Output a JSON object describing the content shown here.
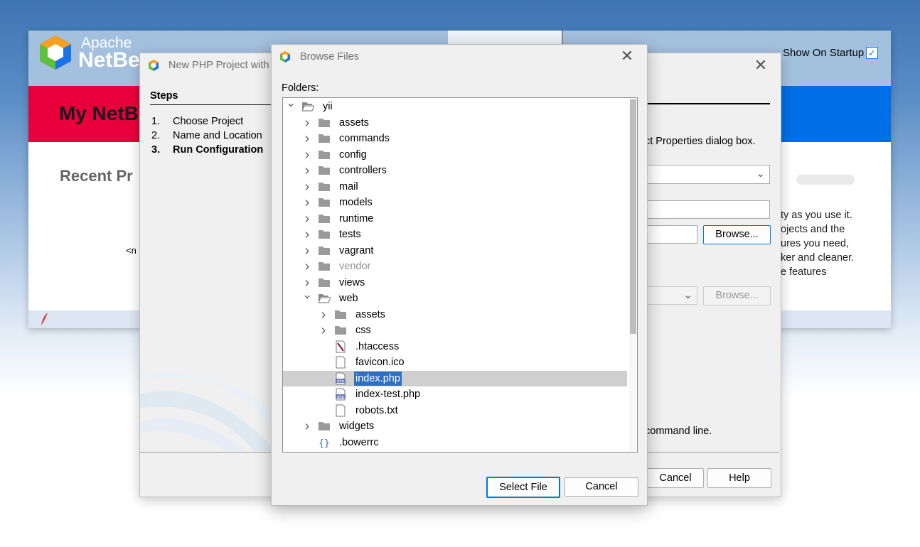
{
  "netbeans": {
    "logo_top": "Apache",
    "logo_bottom": "NetBe",
    "show_on_startup_label": "Show On Startup",
    "show_on_startup_checked": true,
    "my_title": "My NetB",
    "recent_projects": "Recent Pr",
    "no_projects": "<n",
    "right_text": [
      "ty as you use it.",
      "ojects and the",
      "ures you need,",
      "ker and cleaner.",
      "e features"
    ],
    "colors": {
      "red_band": "#e8003c",
      "blue_band": "#006ee6"
    }
  },
  "wizard": {
    "title": "New PHP Project with",
    "steps_heading": "Steps",
    "steps": [
      {
        "num": "1.",
        "label": "Choose Project",
        "current": false
      },
      {
        "num": "2.",
        "label": "Name and Location",
        "current": false
      },
      {
        "num": "3.",
        "label": "Run Configuration",
        "current": true
      }
    ],
    "description": "ct Properties dialog box.",
    "browse_label": "Browse...",
    "browse_disabled_label": "Browse...",
    "cmdline_text": "command line.",
    "cancel_label": "Cancel",
    "help_label": "Help"
  },
  "browse": {
    "title": "Browse Files",
    "folders_label": "Folders:",
    "select_label": "Select File",
    "cancel_label": "Cancel",
    "tree": [
      {
        "label": "yii",
        "depth": 0,
        "type": "folder-open",
        "chevron": "down"
      },
      {
        "label": "assets",
        "depth": 1,
        "type": "folder",
        "chevron": "right"
      },
      {
        "label": "commands",
        "depth": 1,
        "type": "folder",
        "chevron": "right"
      },
      {
        "label": "config",
        "depth": 1,
        "type": "folder",
        "chevron": "right"
      },
      {
        "label": "controllers",
        "depth": 1,
        "type": "folder",
        "chevron": "right"
      },
      {
        "label": "mail",
        "depth": 1,
        "type": "folder",
        "chevron": "right"
      },
      {
        "label": "models",
        "depth": 1,
        "type": "folder",
        "chevron": "right"
      },
      {
        "label": "runtime",
        "depth": 1,
        "type": "folder",
        "chevron": "right"
      },
      {
        "label": "tests",
        "depth": 1,
        "type": "folder",
        "chevron": "right"
      },
      {
        "label": "vagrant",
        "depth": 1,
        "type": "folder",
        "chevron": "right"
      },
      {
        "label": "vendor",
        "depth": 1,
        "type": "folder",
        "chevron": "right",
        "dim": true
      },
      {
        "label": "views",
        "depth": 1,
        "type": "folder",
        "chevron": "right"
      },
      {
        "label": "web",
        "depth": 1,
        "type": "folder-open",
        "chevron": "down"
      },
      {
        "label": "assets",
        "depth": 2,
        "type": "folder",
        "chevron": "right"
      },
      {
        "label": "css",
        "depth": 2,
        "type": "folder",
        "chevron": "right"
      },
      {
        "label": ".htaccess",
        "depth": 2,
        "type": "apache-file"
      },
      {
        "label": "favicon.ico",
        "depth": 2,
        "type": "file"
      },
      {
        "label": "index.php",
        "depth": 2,
        "type": "php-file",
        "selected": true
      },
      {
        "label": "index-test.php",
        "depth": 2,
        "type": "php-file"
      },
      {
        "label": "robots.txt",
        "depth": 2,
        "type": "file"
      },
      {
        "label": "widgets",
        "depth": 1,
        "type": "folder",
        "chevron": "right"
      },
      {
        "label": ".bowerrc",
        "depth": 1,
        "type": "json-file"
      }
    ]
  }
}
